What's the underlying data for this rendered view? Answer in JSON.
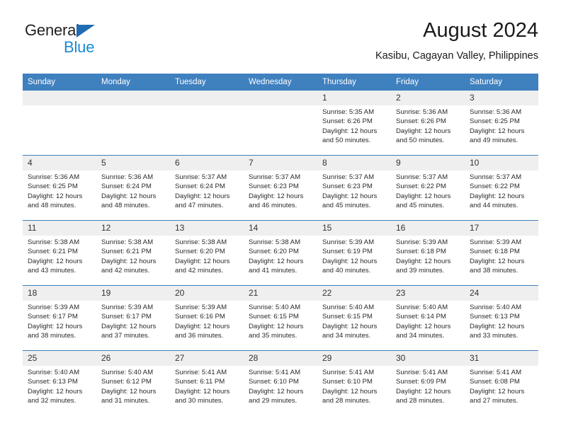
{
  "brand": {
    "word_one": "General",
    "word_two": "Blue",
    "triangle_color": "#1f6cb4",
    "blue_text_color": "#1c8ad4"
  },
  "header": {
    "month_title": "August 2024",
    "location": "Kasibu, Cagayan Valley, Philippines"
  },
  "calendar": {
    "header_bg": "#3f80bf",
    "daynum_bg": "#efefef",
    "weekday_headers": [
      "Sunday",
      "Monday",
      "Tuesday",
      "Wednesday",
      "Thursday",
      "Friday",
      "Saturday"
    ],
    "weeks": [
      [
        {
          "day": "",
          "sunrise": "",
          "sunset": "",
          "daylight": "",
          "empty": true
        },
        {
          "day": "",
          "sunrise": "",
          "sunset": "",
          "daylight": "",
          "empty": true
        },
        {
          "day": "",
          "sunrise": "",
          "sunset": "",
          "daylight": "",
          "empty": true
        },
        {
          "day": "",
          "sunrise": "",
          "sunset": "",
          "daylight": "",
          "empty": true
        },
        {
          "day": "1",
          "sunrise": "Sunrise: 5:35 AM",
          "sunset": "Sunset: 6:26 PM",
          "daylight": "Daylight: 12 hours and 50 minutes."
        },
        {
          "day": "2",
          "sunrise": "Sunrise: 5:36 AM",
          "sunset": "Sunset: 6:26 PM",
          "daylight": "Daylight: 12 hours and 50 minutes."
        },
        {
          "day": "3",
          "sunrise": "Sunrise: 5:36 AM",
          "sunset": "Sunset: 6:25 PM",
          "daylight": "Daylight: 12 hours and 49 minutes."
        }
      ],
      [
        {
          "day": "4",
          "sunrise": "Sunrise: 5:36 AM",
          "sunset": "Sunset: 6:25 PM",
          "daylight": "Daylight: 12 hours and 48 minutes."
        },
        {
          "day": "5",
          "sunrise": "Sunrise: 5:36 AM",
          "sunset": "Sunset: 6:24 PM",
          "daylight": "Daylight: 12 hours and 48 minutes."
        },
        {
          "day": "6",
          "sunrise": "Sunrise: 5:37 AM",
          "sunset": "Sunset: 6:24 PM",
          "daylight": "Daylight: 12 hours and 47 minutes."
        },
        {
          "day": "7",
          "sunrise": "Sunrise: 5:37 AM",
          "sunset": "Sunset: 6:23 PM",
          "daylight": "Daylight: 12 hours and 46 minutes."
        },
        {
          "day": "8",
          "sunrise": "Sunrise: 5:37 AM",
          "sunset": "Sunset: 6:23 PM",
          "daylight": "Daylight: 12 hours and 45 minutes."
        },
        {
          "day": "9",
          "sunrise": "Sunrise: 5:37 AM",
          "sunset": "Sunset: 6:22 PM",
          "daylight": "Daylight: 12 hours and 45 minutes."
        },
        {
          "day": "10",
          "sunrise": "Sunrise: 5:37 AM",
          "sunset": "Sunset: 6:22 PM",
          "daylight": "Daylight: 12 hours and 44 minutes."
        }
      ],
      [
        {
          "day": "11",
          "sunrise": "Sunrise: 5:38 AM",
          "sunset": "Sunset: 6:21 PM",
          "daylight": "Daylight: 12 hours and 43 minutes."
        },
        {
          "day": "12",
          "sunrise": "Sunrise: 5:38 AM",
          "sunset": "Sunset: 6:21 PM",
          "daylight": "Daylight: 12 hours and 42 minutes."
        },
        {
          "day": "13",
          "sunrise": "Sunrise: 5:38 AM",
          "sunset": "Sunset: 6:20 PM",
          "daylight": "Daylight: 12 hours and 42 minutes."
        },
        {
          "day": "14",
          "sunrise": "Sunrise: 5:38 AM",
          "sunset": "Sunset: 6:20 PM",
          "daylight": "Daylight: 12 hours and 41 minutes."
        },
        {
          "day": "15",
          "sunrise": "Sunrise: 5:39 AM",
          "sunset": "Sunset: 6:19 PM",
          "daylight": "Daylight: 12 hours and 40 minutes."
        },
        {
          "day": "16",
          "sunrise": "Sunrise: 5:39 AM",
          "sunset": "Sunset: 6:18 PM",
          "daylight": "Daylight: 12 hours and 39 minutes."
        },
        {
          "day": "17",
          "sunrise": "Sunrise: 5:39 AM",
          "sunset": "Sunset: 6:18 PM",
          "daylight": "Daylight: 12 hours and 38 minutes."
        }
      ],
      [
        {
          "day": "18",
          "sunrise": "Sunrise: 5:39 AM",
          "sunset": "Sunset: 6:17 PM",
          "daylight": "Daylight: 12 hours and 38 minutes."
        },
        {
          "day": "19",
          "sunrise": "Sunrise: 5:39 AM",
          "sunset": "Sunset: 6:17 PM",
          "daylight": "Daylight: 12 hours and 37 minutes."
        },
        {
          "day": "20",
          "sunrise": "Sunrise: 5:39 AM",
          "sunset": "Sunset: 6:16 PM",
          "daylight": "Daylight: 12 hours and 36 minutes."
        },
        {
          "day": "21",
          "sunrise": "Sunrise: 5:40 AM",
          "sunset": "Sunset: 6:15 PM",
          "daylight": "Daylight: 12 hours and 35 minutes."
        },
        {
          "day": "22",
          "sunrise": "Sunrise: 5:40 AM",
          "sunset": "Sunset: 6:15 PM",
          "daylight": "Daylight: 12 hours and 34 minutes."
        },
        {
          "day": "23",
          "sunrise": "Sunrise: 5:40 AM",
          "sunset": "Sunset: 6:14 PM",
          "daylight": "Daylight: 12 hours and 34 minutes."
        },
        {
          "day": "24",
          "sunrise": "Sunrise: 5:40 AM",
          "sunset": "Sunset: 6:13 PM",
          "daylight": "Daylight: 12 hours and 33 minutes."
        }
      ],
      [
        {
          "day": "25",
          "sunrise": "Sunrise: 5:40 AM",
          "sunset": "Sunset: 6:13 PM",
          "daylight": "Daylight: 12 hours and 32 minutes."
        },
        {
          "day": "26",
          "sunrise": "Sunrise: 5:40 AM",
          "sunset": "Sunset: 6:12 PM",
          "daylight": "Daylight: 12 hours and 31 minutes."
        },
        {
          "day": "27",
          "sunrise": "Sunrise: 5:41 AM",
          "sunset": "Sunset: 6:11 PM",
          "daylight": "Daylight: 12 hours and 30 minutes."
        },
        {
          "day": "28",
          "sunrise": "Sunrise: 5:41 AM",
          "sunset": "Sunset: 6:10 PM",
          "daylight": "Daylight: 12 hours and 29 minutes."
        },
        {
          "day": "29",
          "sunrise": "Sunrise: 5:41 AM",
          "sunset": "Sunset: 6:10 PM",
          "daylight": "Daylight: 12 hours and 28 minutes."
        },
        {
          "day": "30",
          "sunrise": "Sunrise: 5:41 AM",
          "sunset": "Sunset: 6:09 PM",
          "daylight": "Daylight: 12 hours and 28 minutes."
        },
        {
          "day": "31",
          "sunrise": "Sunrise: 5:41 AM",
          "sunset": "Sunset: 6:08 PM",
          "daylight": "Daylight: 12 hours and 27 minutes."
        }
      ]
    ]
  }
}
